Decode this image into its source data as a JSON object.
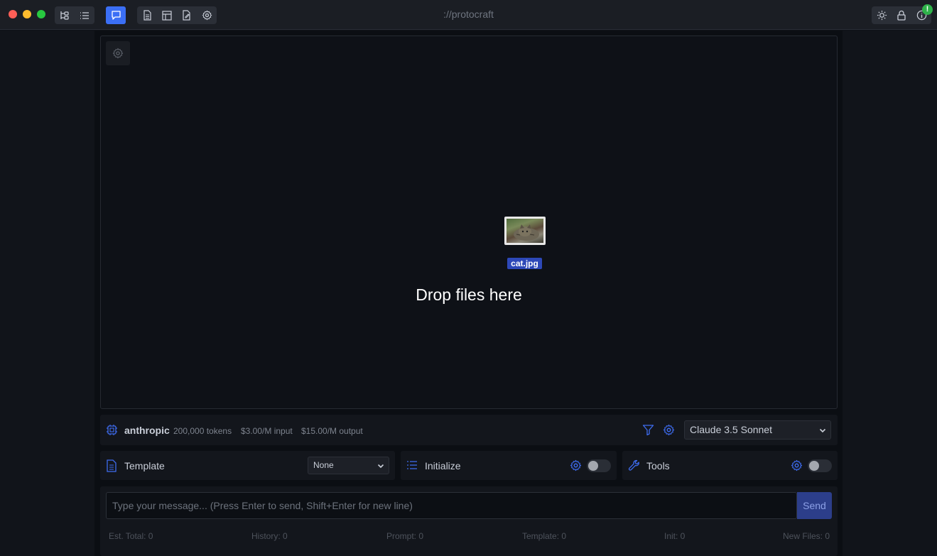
{
  "window": {
    "title": "://protocraft"
  },
  "toolbar": {
    "left_group_1": [
      "tree-icon",
      "list-icon"
    ],
    "active_view": "chat-icon",
    "left_group_2": [
      "document-icon",
      "layout-icon",
      "file-edit-icon",
      "gear-icon"
    ],
    "right_group": [
      "sun-icon",
      "lock-icon",
      "info-icon"
    ],
    "notification_badge": "!"
  },
  "drop_zone": {
    "file_name": "cat.jpg",
    "message": "Drop files here"
  },
  "model_bar": {
    "provider": "anthropic",
    "tokens": "200,000 tokens",
    "input_price": "$3.00/M input",
    "output_price": "$15.00/M output",
    "selected_model": "Claude 3.5 Sonnet"
  },
  "panels": {
    "template_label": "Template",
    "template_value": "None",
    "initialize_label": "Initialize",
    "tools_label": "Tools"
  },
  "composer": {
    "placeholder": "Type your message... (Press Enter to send, Shift+Enter for new line)",
    "send_label": "Send",
    "stats": {
      "est_total": "Est. Total: 0",
      "history": "History: 0",
      "prompt": "Prompt: 0",
      "template": "Template: 0",
      "init": "Init: 0",
      "new_files": "New Files: 0"
    }
  },
  "colors": {
    "accent": "#3b6ff5",
    "background": "#0f1218",
    "badge": "#2fb34a"
  }
}
